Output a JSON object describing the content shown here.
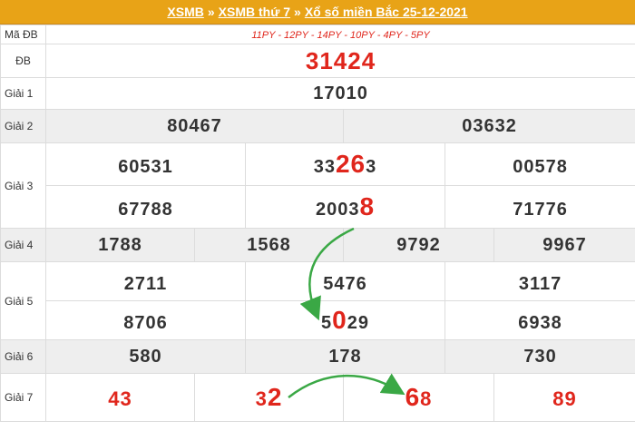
{
  "header": {
    "link1": "XSMB",
    "sep1": "»",
    "link2": "XSMB thứ 7",
    "sep2": "»",
    "link3": "Xổ số miền Bắc 25-12-2021"
  },
  "rows": {
    "ma_db": {
      "label": "Mã ĐB",
      "value": "11PY - 12PY - 14PY - 10PY - 4PY - 5PY"
    },
    "db": {
      "label": "ĐB",
      "value": "31424"
    },
    "g1": {
      "label": "Giải 1",
      "values": [
        "17010"
      ]
    },
    "g2": {
      "label": "Giải 2",
      "values": [
        "80467",
        "03632"
      ]
    },
    "g3": {
      "label": "Giải 3",
      "values": [
        {
          "pre": "60531",
          "hl": "",
          "post": ""
        },
        {
          "pre": "33",
          "hl": "26",
          "post": "3"
        },
        {
          "pre": "00578",
          "hl": "",
          "post": ""
        },
        {
          "pre": "67788",
          "hl": "",
          "post": ""
        },
        {
          "pre": "2003",
          "hl": "8",
          "post": ""
        },
        {
          "pre": "71776",
          "hl": "",
          "post": ""
        }
      ]
    },
    "g4": {
      "label": "Giải 4",
      "values": [
        "1788",
        "1568",
        "9792",
        "9967"
      ]
    },
    "g5": {
      "label": "Giải 5",
      "values": [
        {
          "pre": "2711",
          "hl": "",
          "post": ""
        },
        {
          "pre": "5476",
          "hl": "",
          "post": ""
        },
        {
          "pre": "3117",
          "hl": "",
          "post": ""
        },
        {
          "pre": "8706",
          "hl": "",
          "post": ""
        },
        {
          "pre": "5",
          "hl": "0",
          "post": "29"
        },
        {
          "pre": "6938",
          "hl": "",
          "post": ""
        }
      ]
    },
    "g6": {
      "label": "Giải 6",
      "values": [
        "580",
        "178",
        "730"
      ]
    },
    "g7": {
      "label": "Giải 7",
      "values": [
        {
          "pre": "43",
          "hl": "",
          "post": ""
        },
        {
          "pre": "3",
          "hl": "2",
          "post": ""
        },
        {
          "pre": "",
          "hl": "6",
          "post": "8"
        },
        {
          "pre": "89",
          "hl": "",
          "post": ""
        }
      ]
    }
  },
  "colors": {
    "header_bg": "#e8a317",
    "red": "#e0261c",
    "arrow": "#3aa845",
    "band": "#eeeeee"
  }
}
